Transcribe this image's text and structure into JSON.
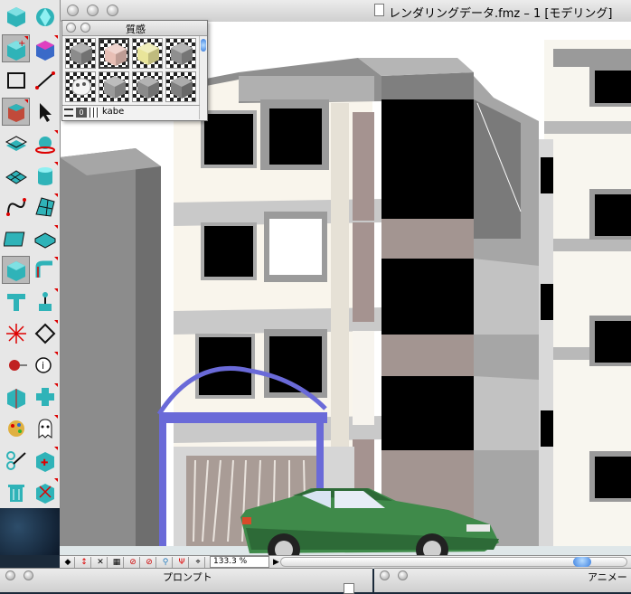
{
  "main_window": {
    "title": "レンダリングデータ.fmz – 1 [モデリング]",
    "icon": "document-icon"
  },
  "material_panel": {
    "title": "質感",
    "selected_material": "kabe",
    "swatch_colors": [
      "#8c8c8c",
      "#e8bfb5",
      "#e9e59a",
      "#8f8f8f",
      "#f4f4f4",
      "#9a9a9a",
      "#8a8a8a",
      "#7f7f7f"
    ],
    "counter_label": "0"
  },
  "status_bar": {
    "zoom": "133.3 %"
  },
  "prompt_window": {
    "title": "プロンプト"
  },
  "animation_window": {
    "title": "アニメー"
  },
  "tools": {
    "icons": [
      "cube-icon",
      "sphere-icon",
      "cube-add-icon",
      "texture-cube-icon",
      "rectangle-icon",
      "line-icon",
      "box-select-icon",
      "arrow-pointer-icon",
      "plane-icon",
      "rotate-icon",
      "grid-plane-icon",
      "cylinder-icon",
      "curve-icon",
      "mesh-icon",
      "flat-rect-icon",
      "flat-box-icon",
      "box-frame-icon",
      "sweep-icon",
      "t-shape-icon",
      "joystick-icon",
      "light-icon",
      "diamond-icon",
      "red-sphere-icon",
      "info-icon",
      "box-split-icon",
      "cross-icon",
      "paint-icon",
      "ghost-icon",
      "scissors-icon",
      "puzzle-icon",
      "trash-icon",
      "explode-icon"
    ]
  },
  "colors": {
    "accent_blue": "#3b7fe0",
    "arch_blue": "#6a6ad8",
    "car_green": "#3f8a4a"
  }
}
